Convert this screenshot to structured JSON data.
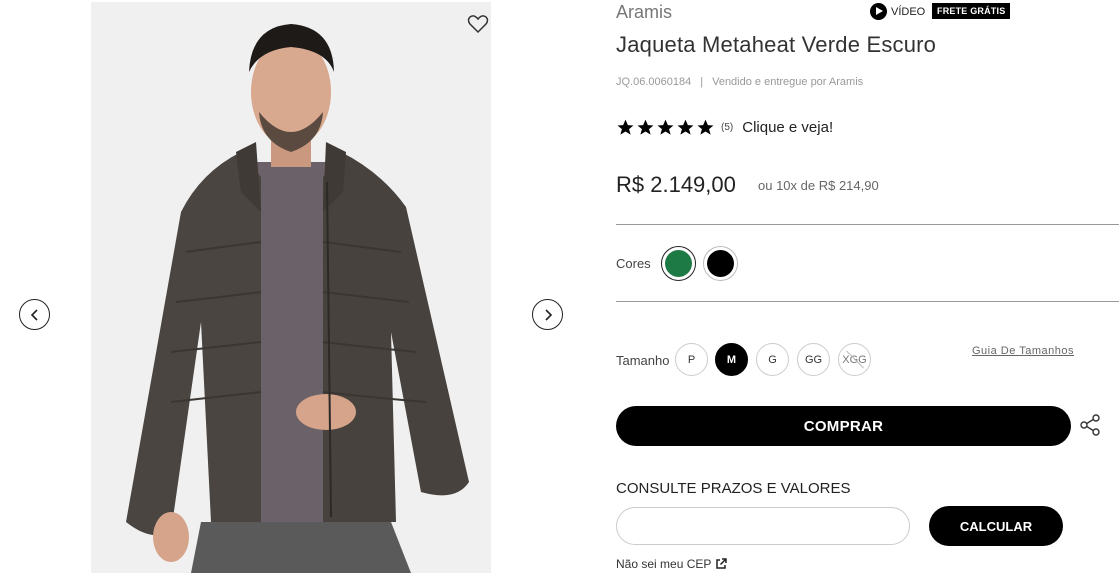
{
  "product": {
    "brand": "Aramis",
    "video_label": "VÍDEO",
    "shipping_badge": "FRETE GRÁTIS",
    "title": "Jaqueta Metaheat Verde Escuro",
    "sku": "JQ.06.0060184",
    "separator": "|",
    "seller": "Vendido e entregue por Aramis",
    "rating": {
      "stars": 5,
      "count": "(5)",
      "cta": "Clique e veja!"
    },
    "price": "R$ 2.149,00",
    "installments": "ou 10x de R$ 214,90"
  },
  "colors": {
    "label": "Cores",
    "options": [
      {
        "name": "verde-escuro",
        "hex": "#1e7a44",
        "selected": true
      },
      {
        "name": "preto",
        "hex": "#000000",
        "selected": false
      }
    ]
  },
  "sizes": {
    "label": "Tamanho",
    "options": [
      {
        "label": "P",
        "selected": false,
        "available": true
      },
      {
        "label": "M",
        "selected": true,
        "available": true
      },
      {
        "label": "G",
        "selected": false,
        "available": true
      },
      {
        "label": "GG",
        "selected": false,
        "available": true
      },
      {
        "label": "XGG",
        "selected": false,
        "available": false
      }
    ],
    "guide_label": "Guia De Tamanhos"
  },
  "actions": {
    "buy_label": "COMPRAR"
  },
  "shipping": {
    "title": "CONSULTE PRAZOS E VALORES",
    "cep_value": "",
    "calculate_label": "CALCULAR",
    "no_cep_label": "Não sei meu CEP"
  },
  "gallery": {
    "icons": [
      "heart-icon",
      "chevron-left-icon",
      "chevron-right-icon",
      "share-icon",
      "play-icon",
      "external-link-icon",
      "star-icon"
    ]
  },
  "theme": {
    "accent": "#000000",
    "selected_color": "#1e7a44",
    "text_muted": "#999999"
  }
}
